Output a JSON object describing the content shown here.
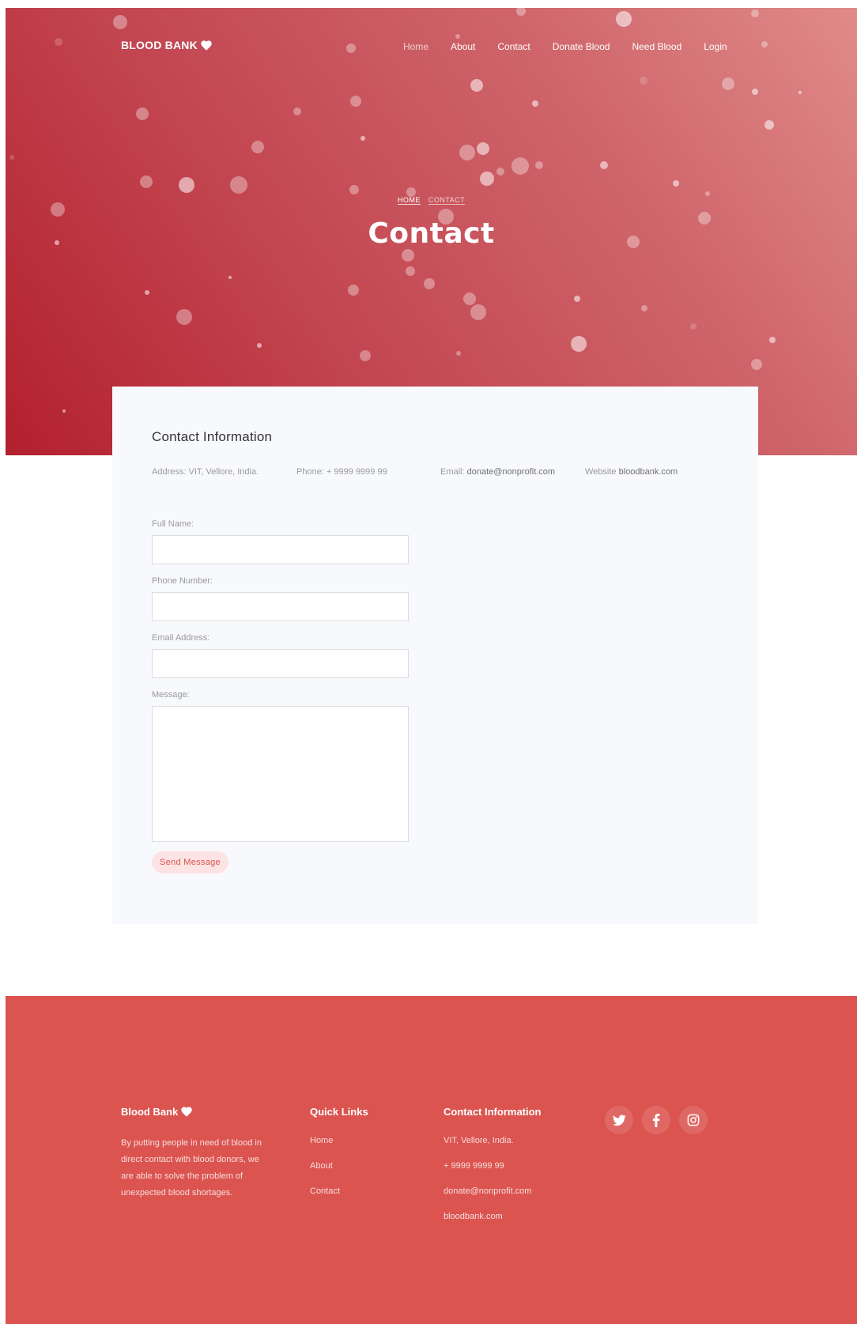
{
  "brand": {
    "name": "BLOOD BANK"
  },
  "nav": {
    "items": [
      {
        "label": "Home"
      },
      {
        "label": "About"
      },
      {
        "label": "Contact"
      },
      {
        "label": "Donate Blood"
      },
      {
        "label": "Need Blood"
      },
      {
        "label": "Login"
      }
    ]
  },
  "hero": {
    "breadcrumb_home": "HOME",
    "breadcrumb_current": "CONTACT",
    "title": "Contact"
  },
  "contact": {
    "heading": "Contact Information",
    "address_label": "Address:",
    "address_value": "VIT, Vellore, India.",
    "phone_label": "Phone:",
    "phone_value": "+ 9999 9999 99",
    "email_label": "Email:",
    "email_value": "donate@nonprofit.com",
    "website_label": "Website",
    "website_value": "bloodbank.com"
  },
  "form": {
    "full_name_label": "Full Name:",
    "full_name_value": "",
    "phone_label": "Phone Number:",
    "phone_value": "",
    "email_label": "Email Address:",
    "email_value": "",
    "message_label": "Message:",
    "message_value": "",
    "submit_label": "Send Message"
  },
  "footer": {
    "brand": "Blood Bank",
    "about_text": "By putting people in need of blood in direct contact with blood donors, we are able to solve the problem of unexpected blood shortages.",
    "quick_links_heading": "Quick Links",
    "quick_links": [
      "Home",
      "About",
      "Contact"
    ],
    "contact_heading": "Contact Information",
    "contact_items": [
      "VIT, Vellore, India.",
      "+ 9999 9999 99",
      "donate@nonprofit.com",
      "bloodbank.com"
    ],
    "social": [
      {
        "icon": "twitter-icon"
      },
      {
        "icon": "facebook-icon"
      },
      {
        "icon": "instagram-icon"
      }
    ]
  },
  "colors": {
    "hero_start": "#b3202d",
    "hero_end": "#e08a89",
    "footer_bg": "#db5450",
    "card_bg": "#f8f9fd",
    "button_bg": "#fde3e4",
    "button_text": "#d9534f"
  }
}
